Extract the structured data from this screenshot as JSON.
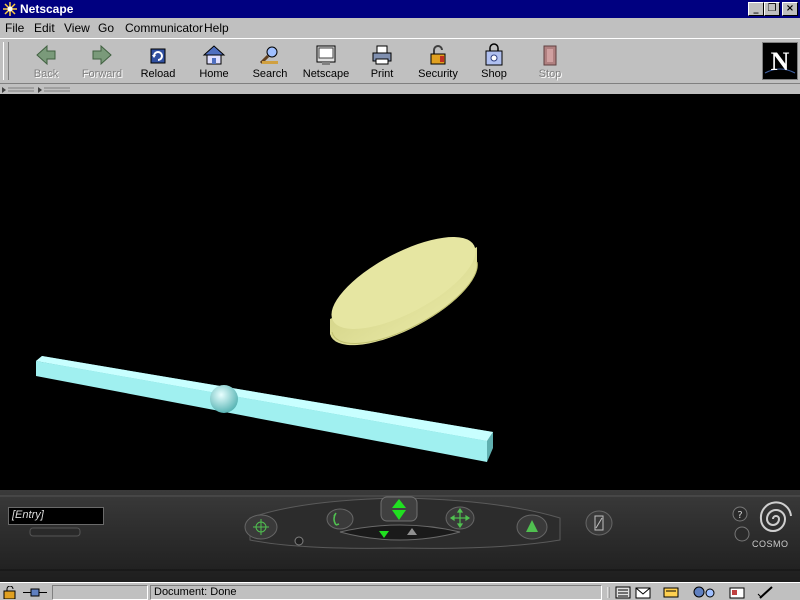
{
  "window": {
    "title": "Netscape",
    "controls": [
      "minimize",
      "maximize",
      "close"
    ]
  },
  "menu": [
    "File",
    "Edit",
    "View",
    "Go",
    "Communicator",
    "Help"
  ],
  "toolbar": {
    "buttons": [
      {
        "label": "Back",
        "icon": "back-arrow-icon",
        "enabled": false
      },
      {
        "label": "Forward",
        "icon": "forward-arrow-icon",
        "enabled": false
      },
      {
        "label": "Reload",
        "icon": "reload-icon",
        "enabled": true
      },
      {
        "label": "Home",
        "icon": "home-icon",
        "enabled": true
      },
      {
        "label": "Search",
        "icon": "search-icon",
        "enabled": true
      },
      {
        "label": "Netscape",
        "icon": "my-netscape-icon",
        "enabled": true
      },
      {
        "label": "Print",
        "icon": "printer-icon",
        "enabled": true
      },
      {
        "label": "Security",
        "icon": "padlock-icon",
        "enabled": true
      },
      {
        "label": "Shop",
        "icon": "shopping-bag-icon",
        "enabled": true
      },
      {
        "label": "Stop",
        "icon": "stop-icon",
        "enabled": false
      }
    ],
    "logo_letter": "N"
  },
  "scene": {
    "background": "#000000",
    "objects": [
      {
        "name": "disc",
        "color": "#e6e6a0"
      },
      {
        "name": "bar",
        "color": "#a0f0f0"
      },
      {
        "name": "sphere",
        "color": "#a0f0f0"
      }
    ]
  },
  "console": {
    "viewpoint": "[Entry]",
    "brand": "COSMO"
  },
  "status": {
    "text": "Document: Done"
  },
  "colors": {
    "titlebar": "#000080",
    "chrome": "#c0c0c0",
    "nav_green": "#20e020"
  }
}
